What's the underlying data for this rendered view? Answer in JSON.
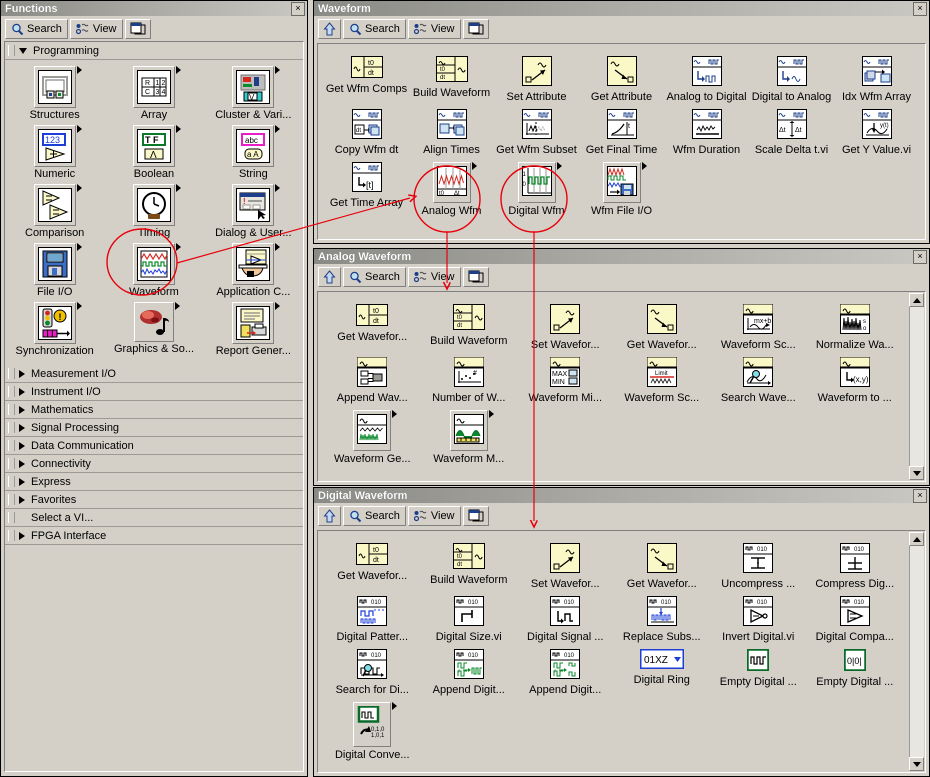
{
  "functions_window": {
    "title": "Functions",
    "toolbar": {
      "search_label": "Search",
      "view_label": "View",
      "pin_label": ""
    },
    "programming": {
      "label": "Programming",
      "items": [
        {
          "label": "Structures",
          "icon": "structures-icon"
        },
        {
          "label": "Array",
          "icon": "array-icon"
        },
        {
          "label": "Cluster & Vari...",
          "icon": "cluster-icon"
        },
        {
          "label": "Numeric",
          "icon": "numeric-icon"
        },
        {
          "label": "Boolean",
          "icon": "boolean-icon"
        },
        {
          "label": "String",
          "icon": "string-icon"
        },
        {
          "label": "Comparison",
          "icon": "comparison-icon"
        },
        {
          "label": "Timing",
          "icon": "timing-icon"
        },
        {
          "label": "Dialog & User...",
          "icon": "dialog-icon"
        },
        {
          "label": "File I/O",
          "icon": "file-io-icon"
        },
        {
          "label": "Waveform",
          "icon": "waveform-icon"
        },
        {
          "label": "Application C...",
          "icon": "application-control-icon"
        },
        {
          "label": "Synchronization",
          "icon": "synchronization-icon"
        },
        {
          "label": "Graphics & So...",
          "icon": "graphics-sound-icon"
        },
        {
          "label": "Report Gener...",
          "icon": "report-generation-icon"
        }
      ]
    },
    "categories": [
      {
        "label": "Measurement I/O",
        "expandable": true
      },
      {
        "label": "Instrument I/O",
        "expandable": true
      },
      {
        "label": "Mathematics",
        "expandable": true
      },
      {
        "label": "Signal Processing",
        "expandable": true
      },
      {
        "label": "Data Communication",
        "expandable": true
      },
      {
        "label": "Connectivity",
        "expandable": true
      },
      {
        "label": "Express",
        "expandable": true
      },
      {
        "label": "Favorites",
        "expandable": true
      },
      {
        "label": "Select a VI...",
        "expandable": false
      },
      {
        "label": "FPGA Interface",
        "expandable": true
      }
    ]
  },
  "waveform_window": {
    "title": "Waveform",
    "toolbar": {
      "up_label": "",
      "search_label": "Search",
      "view_label": "View",
      "pin_label": ""
    },
    "items": [
      {
        "label": "Get Wfm Comps",
        "icon": "get-wfm-comps-icon"
      },
      {
        "label": "Build Waveform",
        "icon": "build-waveform-icon"
      },
      {
        "label": "Set Attribute",
        "icon": "set-attribute-icon"
      },
      {
        "label": "Get Attribute",
        "icon": "get-attribute-icon"
      },
      {
        "label": "Analog to Digital",
        "icon": "analog-to-digital-icon"
      },
      {
        "label": "Digital to Analog",
        "icon": "digital-to-analog-icon"
      },
      {
        "label": "Idx Wfm Array",
        "icon": "idx-wfm-array-icon"
      },
      {
        "label": "Copy Wfm dt",
        "icon": "copy-wfm-dt-icon"
      },
      {
        "label": "Align Times",
        "icon": "align-times-icon"
      },
      {
        "label": "Get Wfm Subset",
        "icon": "get-wfm-subset-icon"
      },
      {
        "label": "Get Final Time",
        "icon": "get-final-time-icon"
      },
      {
        "label": "Wfm Duration",
        "icon": "wfm-duration-icon"
      },
      {
        "label": "Scale Delta t.vi",
        "icon": "scale-delta-t-icon"
      },
      {
        "label": "Get  Y Value.vi",
        "icon": "get-y-value-icon"
      },
      {
        "label": "Get Time Array",
        "icon": "get-time-array-icon"
      },
      {
        "label": "Analog Wfm",
        "icon": "analog-wfm-subpalette-icon"
      },
      {
        "label": "Digital Wfm",
        "icon": "digital-wfm-subpalette-icon"
      },
      {
        "label": "Wfm File I/O",
        "icon": "wfm-file-io-subpalette-icon"
      }
    ]
  },
  "analog_window": {
    "title": "Analog Waveform",
    "toolbar": {
      "up_label": "",
      "search_label": "Search",
      "view_label": "View",
      "pin_label": ""
    },
    "items": [
      {
        "label": "Get Wavefor...",
        "icon": "get-waveform-components-icon"
      },
      {
        "label": "Build Waveform",
        "icon": "build-waveform-icon"
      },
      {
        "label": "Set Wavefor...",
        "icon": "set-waveform-attribute-icon"
      },
      {
        "label": "Get Wavefor...",
        "icon": "get-waveform-attribute-icon"
      },
      {
        "label": "Waveform Sc...",
        "icon": "waveform-scaling-icon"
      },
      {
        "label": "Normalize Wa...",
        "icon": "normalize-waveform-icon"
      },
      {
        "label": "Append Wav...",
        "icon": "append-waveforms-icon"
      },
      {
        "label": "Number of W...",
        "icon": "number-of-waveform-samples-icon"
      },
      {
        "label": "Waveform Mi...",
        "icon": "waveform-min-max-icon"
      },
      {
        "label": "Waveform Sc...",
        "icon": "waveform-limit-icon"
      },
      {
        "label": "Search Wave...",
        "icon": "search-waveform-icon"
      },
      {
        "label": "Waveform to ...",
        "icon": "waveform-to-xy-icon"
      },
      {
        "label": "Waveform Ge...",
        "icon": "waveform-generation-subpalette-icon"
      },
      {
        "label": "Waveform M...",
        "icon": "waveform-measurements-subpalette-icon"
      }
    ]
  },
  "digital_window": {
    "title": "Digital Waveform",
    "toolbar": {
      "up_label": "",
      "search_label": "Search",
      "view_label": "View",
      "pin_label": ""
    },
    "items": [
      {
        "label": "Get Wavefor...",
        "icon": "get-waveform-components-icon"
      },
      {
        "label": "Build Waveform",
        "icon": "build-waveform-icon"
      },
      {
        "label": "Set Wavefor...",
        "icon": "set-waveform-attribute-icon"
      },
      {
        "label": "Get Wavefor...",
        "icon": "get-waveform-attribute-icon"
      },
      {
        "label": "Uncompress ...",
        "icon": "uncompress-digital-icon"
      },
      {
        "label": "Compress Dig...",
        "icon": "compress-digital-icon"
      },
      {
        "label": "Digital Patter...",
        "icon": "digital-pattern-icon"
      },
      {
        "label": "Digital Size.vi",
        "icon": "digital-size-icon"
      },
      {
        "label": "Digital Signal ...",
        "icon": "digital-signal-subset-icon"
      },
      {
        "label": "Replace Subs...",
        "icon": "replace-subset-icon"
      },
      {
        "label": "Invert Digital.vi",
        "icon": "invert-digital-icon"
      },
      {
        "label": "Digital Compa...",
        "icon": "digital-comparison-icon"
      },
      {
        "label": "Search for Di...",
        "icon": "search-for-digital-pattern-icon"
      },
      {
        "label": "Append Digit...",
        "icon": "append-digital-samples-icon"
      },
      {
        "label": "Append Digit...",
        "icon": "append-digital-signals-icon"
      },
      {
        "label": "Digital Ring",
        "icon": "digital-ring-icon"
      },
      {
        "label": "Empty Digital ...",
        "icon": "empty-digital-waveform-icon"
      },
      {
        "label": "Empty Digital ...",
        "icon": "empty-digital-data-icon"
      },
      {
        "label": "Digital Conve...",
        "icon": "digital-conversion-subpalette-icon"
      }
    ]
  },
  "annotations": {
    "color": "#e8000b",
    "marks": [
      {
        "name": "waveform-circle",
        "shape": "ellipse"
      },
      {
        "name": "analog-wfm-circle",
        "shape": "ellipse"
      },
      {
        "name": "digital-wfm-circle",
        "shape": "ellipse"
      },
      {
        "name": "waveform-to-palette-arrow",
        "shape": "arrow"
      },
      {
        "name": "analog-wfm-to-view-arrow",
        "shape": "arrow"
      },
      {
        "name": "digital-wfm-to-view-arrow",
        "shape": "arrow"
      }
    ]
  },
  "icon_glyphs": {
    "search": "search-icon",
    "view": "view-icon",
    "pin": "pin-icon",
    "up": "up-arrow-icon",
    "close": "×",
    "scroll_up": "scroll-up-arrow",
    "scroll_down": "scroll-down-arrow"
  }
}
